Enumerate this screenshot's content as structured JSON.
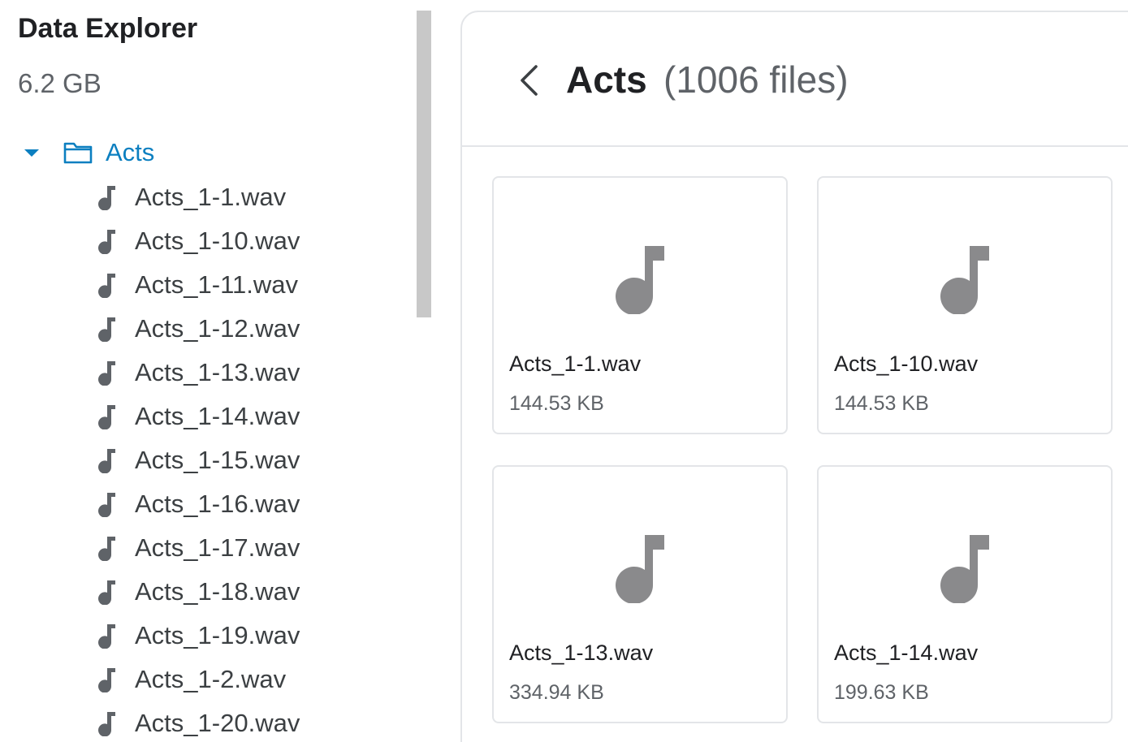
{
  "sidebar": {
    "title": "Data Explorer",
    "size": "6.2 GB",
    "tree": {
      "root_label": "Acts",
      "files": [
        "Acts_1-1.wav",
        "Acts_1-10.wav",
        "Acts_1-11.wav",
        "Acts_1-12.wav",
        "Acts_1-13.wav",
        "Acts_1-14.wav",
        "Acts_1-15.wav",
        "Acts_1-16.wav",
        "Acts_1-17.wav",
        "Acts_1-18.wav",
        "Acts_1-19.wav",
        "Acts_1-2.wav",
        "Acts_1-20.wav"
      ]
    }
  },
  "main": {
    "title": "Acts",
    "count": "(1006 files)",
    "cards": [
      {
        "name": "Acts_1-1.wav",
        "size": "144.53 KB"
      },
      {
        "name": "Acts_1-10.wav",
        "size": "144.53 KB"
      },
      {
        "name": "Acts_1-13.wav",
        "size": "334.94 KB"
      },
      {
        "name": "Acts_1-14.wav",
        "size": "199.63 KB"
      }
    ]
  },
  "icons": {
    "tree_caret": "caret-down-icon",
    "folder": "folder-icon",
    "file": "music-note-icon",
    "back": "chevron-left-icon"
  },
  "colors": {
    "accent": "#0b7fc0",
    "icon_gray": "#8a8a8c",
    "border": "#e3e5e8",
    "scrollbar": "#c8c8c8"
  }
}
